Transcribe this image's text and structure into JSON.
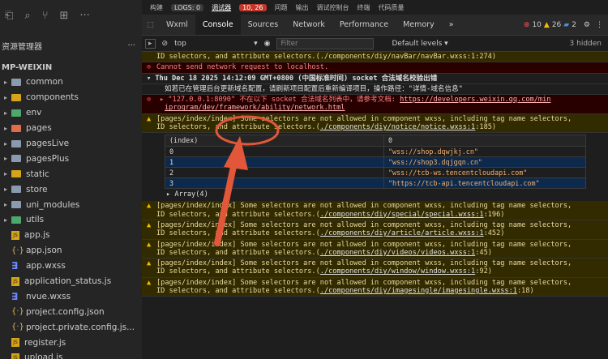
{
  "sidebar": {
    "explorer_title": "资源管理器",
    "more": "···",
    "project": "MP-WEIXIN",
    "items": [
      {
        "label": "common",
        "kind": "folder",
        "color": "#8a9bb0"
      },
      {
        "label": "components",
        "kind": "folder",
        "color": "#d6a419"
      },
      {
        "label": "env",
        "kind": "folder",
        "color": "#4fa86b"
      },
      {
        "label": "pages",
        "kind": "folder",
        "color": "#e06c4a"
      },
      {
        "label": "pagesLive",
        "kind": "folder",
        "color": "#8a9bb0"
      },
      {
        "label": "pagesPlus",
        "kind": "folder",
        "color": "#8a9bb0"
      },
      {
        "label": "static",
        "kind": "folder",
        "color": "#d6a419"
      },
      {
        "label": "store",
        "kind": "folder",
        "color": "#8a9bb0"
      },
      {
        "label": "uni_modules",
        "kind": "folder",
        "color": "#8a9bb0"
      },
      {
        "label": "utils",
        "kind": "folder",
        "color": "#4fa86b"
      },
      {
        "label": "app.js",
        "kind": "js"
      },
      {
        "label": "app.json",
        "kind": "json"
      },
      {
        "label": "app.wxss",
        "kind": "wxss"
      },
      {
        "label": "application_status.js",
        "kind": "js"
      },
      {
        "label": "nvue.wxss",
        "kind": "wxss"
      },
      {
        "label": "project.config.json",
        "kind": "json"
      },
      {
        "label": "project.private.config.js...",
        "kind": "json"
      },
      {
        "label": "register.js",
        "kind": "js"
      },
      {
        "label": "upload.js",
        "kind": "js"
      }
    ]
  },
  "topbar": {
    "build": "构建",
    "logs": "LOGS: 0",
    "debugger": "调试器",
    "debugger_badge": "10, 26",
    "problems": "问题",
    "output": "输出",
    "debug_console": "调试控制台",
    "terminal": "终端",
    "code_quality": "代码质量"
  },
  "devtools": {
    "tabs": [
      "Wxml",
      "Console",
      "Sources",
      "Network",
      "Performance",
      "Memory"
    ],
    "more": "»",
    "errors": "10",
    "warnings": "26",
    "info": "2",
    "context": "top",
    "filter_placeholder": "Filter",
    "levels": "Default levels ▾",
    "hidden": "3 hidden"
  },
  "console": {
    "top_line": "ID selectors, and attribute selectors.(./components/diy/navBar/navBar.wxss:1:274)",
    "cannot_send": "Cannot send network request to localhost.",
    "group_title": "Thu Dec 18 2025 14:12:09 GMT+0800 (中国标准时间) socket 合法域名校验出错",
    "group_info": "如若已在管理后台更新域名配置，请刷新项目配置后重新编译项目，操作路径：\"详情-域名信息\"",
    "err_line1_prefix": "\"127.0.0.1:8090\" 不在以下 socket 合法域名列表中，请参考文档: ",
    "err_link1": "https://developers.weixin.qq.com/min",
    "err_link2": "iprogram/dev/framework/ability/network.html",
    "warn_prefix": "[pages/index/index] Some selectors are not allowed in component wxss, including tag name selectors,",
    "warn_prefix2": "ID selectors, and attribute selectors.(",
    "warn_notice": "./components/diy/notice/notice.wxss:1",
    "warn_notice_suffix": ":185)",
    "table_header": [
      "(index)",
      "0"
    ],
    "table_rows": [
      {
        "k": "0",
        "v": "\"wss://shop.dqwjkj.cn\""
      },
      {
        "k": "1",
        "v": "\"wss://shop3.dqjgqn.cn\""
      },
      {
        "k": "2",
        "v": "\"wss://tcb-ws.tencentcloudapi.com\""
      },
      {
        "k": "3",
        "v": "\"https://tcb-api.tencentcloudapi.com\""
      }
    ],
    "array_label": "▸ Array(4)",
    "warnings": [
      {
        "path": "./components/diy/special/special.wxss:1",
        "suffix": ":196)"
      },
      {
        "path": "./components/diy/article/article.wxss:1",
        "suffix": ":452)"
      },
      {
        "path": "./components/diy/videos/videos.wxss:1",
        "suffix": ":45)"
      },
      {
        "path": "./components/diy/window/window.wxss:1",
        "suffix": ":92)"
      },
      {
        "path": "./components/diy/imagesingle/imagesingle.wxss:1",
        "suffix": ":18)"
      }
    ]
  },
  "colors": {
    "accent_arrow": "#e2573a",
    "error_bg": "#290000",
    "warn_bg": "#332b00"
  }
}
